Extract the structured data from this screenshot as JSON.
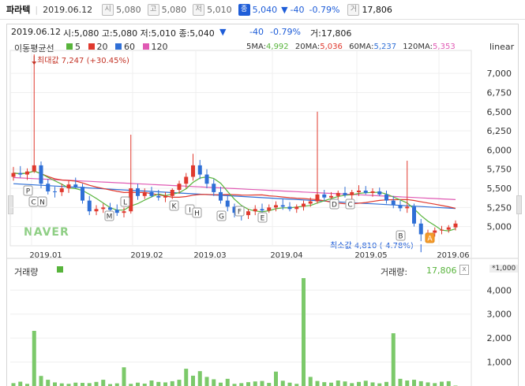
{
  "header": {
    "stock_name": "파라텍",
    "date": "2019.06.12",
    "open_icon": "시",
    "open": "5,080",
    "high_icon": "고",
    "high": "5,080",
    "low_icon": "저",
    "low": "5,010",
    "close_icon": "종",
    "close": "5,040",
    "change_arrow": "▼",
    "change": "-40",
    "change_pct": "-0.79%",
    "volume_icon": "거",
    "volume": "17,806"
  },
  "info_bar": {
    "date": "2019.06.12",
    "ohlc": "시:5,080  고:5,080  저:5,010  종:5,040",
    "change_arrow": "▼",
    "change": "-40",
    "change_pct": "-0.79%",
    "volume": "거:17,806"
  },
  "ma_legend": {
    "title": "이동평균선",
    "items": [
      {
        "label": "5",
        "color": "#58b43c"
      },
      {
        "label": "20",
        "color": "#e0392e"
      },
      {
        "label": "60",
        "color": "#2f6fd6"
      },
      {
        "label": "120",
        "color": "#e05ab4"
      }
    ],
    "values": [
      {
        "label": "5MA:",
        "value": "4,992",
        "color": "#58b43c"
      },
      {
        "label": "20MA:",
        "value": "5,036",
        "color": "#e0392e"
      },
      {
        "label": "60MA:",
        "value": "5,237",
        "color": "#2f6fd6"
      },
      {
        "label": "120MA:",
        "value": "5,353",
        "color": "#e05ab4"
      }
    ],
    "scale": "linear"
  },
  "annotations": {
    "max_label": "최대값 7,247 (+30.45%)",
    "min_label": "최소값 4,810 (-4.78%)",
    "watermark": "NAVER",
    "markers": [
      "P",
      "C",
      "N",
      "M",
      "L",
      "K",
      "I",
      "H",
      "G",
      "F",
      "E",
      "D",
      "C",
      "B",
      "A"
    ]
  },
  "volume_panel": {
    "title": "거래량",
    "label": "거래량:",
    "value": "17,806",
    "close_icon": "x",
    "unit": "*1,000"
  },
  "chart_data": [
    {
      "type": "candlestick",
      "title": "",
      "x": [
        "2019.01",
        "2019.02",
        "2019.03",
        "2019.04",
        "2019.05",
        "2019.06"
      ],
      "y_ticks": [
        5000,
        5250,
        5500,
        5750,
        6000,
        6250,
        6500,
        6750,
        7000
      ],
      "ylim": [
        4750,
        7300
      ],
      "ohlc_approx": [
        [
          5650,
          5780,
          5600,
          5700
        ],
        [
          5700,
          5790,
          5640,
          5680
        ],
        [
          5680,
          5760,
          5610,
          5720
        ],
        [
          5720,
          7247,
          5700,
          5800
        ],
        [
          5800,
          5850,
          5500,
          5560
        ],
        [
          5560,
          5620,
          5420,
          5460
        ],
        [
          5460,
          5520,
          5380,
          5450
        ],
        [
          5450,
          5560,
          5400,
          5500
        ],
        [
          5500,
          5600,
          5440,
          5550
        ],
        [
          5550,
          5640,
          5500,
          5520
        ],
        [
          5520,
          5560,
          5300,
          5340
        ],
        [
          5340,
          5400,
          5150,
          5200
        ],
        [
          5200,
          5280,
          5150,
          5230
        ],
        [
          5230,
          5300,
          5180,
          5250
        ],
        [
          5250,
          5310,
          5190,
          5220
        ],
        [
          5220,
          5290,
          5140,
          5180
        ],
        [
          5180,
          5250,
          5120,
          5200
        ],
        [
          5200,
          6200,
          5170,
          5500
        ],
        [
          5500,
          5560,
          5350,
          5400
        ],
        [
          5400,
          5500,
          5360,
          5450
        ],
        [
          5450,
          5520,
          5380,
          5400
        ],
        [
          5400,
          5480,
          5340,
          5380
        ],
        [
          5380,
          5450,
          5320,
          5400
        ],
        [
          5400,
          5500,
          5360,
          5480
        ],
        [
          5480,
          5600,
          5430,
          5560
        ],
        [
          5560,
          5700,
          5500,
          5650
        ],
        [
          5650,
          5950,
          5600,
          5800
        ],
        [
          5800,
          5870,
          5620,
          5680
        ],
        [
          5680,
          5750,
          5500,
          5560
        ],
        [
          5560,
          5620,
          5400,
          5450
        ],
        [
          5450,
          5520,
          5300,
          5340
        ],
        [
          5340,
          5400,
          5200,
          5260
        ],
        [
          5260,
          5300,
          5120,
          5180
        ],
        [
          5180,
          5260,
          5080,
          5150
        ],
        [
          5150,
          5230,
          5100,
          5200
        ],
        [
          5200,
          5280,
          5150,
          5230
        ],
        [
          5230,
          5300,
          5160,
          5210
        ],
        [
          5210,
          5290,
          5180,
          5250
        ],
        [
          5250,
          5330,
          5200,
          5280
        ],
        [
          5280,
          5360,
          5220,
          5260
        ],
        [
          5260,
          5320,
          5200,
          5230
        ],
        [
          5230,
          5290,
          5180,
          5260
        ],
        [
          5260,
          5340,
          5210,
          5300
        ],
        [
          5300,
          5380,
          5260,
          5330
        ],
        [
          5330,
          6500,
          5300,
          5420
        ],
        [
          5420,
          5480,
          5340,
          5380
        ],
        [
          5380,
          5450,
          5320,
          5400
        ],
        [
          5400,
          5470,
          5360,
          5440
        ],
        [
          5440,
          5520,
          5380,
          5410
        ],
        [
          5410,
          5480,
          5360,
          5450
        ],
        [
          5450,
          5540,
          5400,
          5470
        ],
        [
          5470,
          5530,
          5420,
          5440
        ],
        [
          5440,
          5500,
          5390,
          5460
        ],
        [
          5460,
          5510,
          5400,
          5420
        ],
        [
          5420,
          5470,
          5300,
          5340
        ],
        [
          5340,
          5400,
          5240,
          5280
        ],
        [
          5280,
          5340,
          5200,
          5240
        ],
        [
          5240,
          5860,
          5180,
          5260
        ],
        [
          5260,
          5300,
          5000,
          5040
        ],
        [
          5040,
          5100,
          4810,
          4900
        ],
        [
          4900,
          4960,
          4840,
          4920
        ],
        [
          4920,
          4990,
          4870,
          4950
        ],
        [
          4950,
          5010,
          4900,
          4960
        ],
        [
          4960,
          5020,
          4920,
          4990
        ],
        [
          4990,
          5080,
          4950,
          5040
        ]
      ],
      "ma": {
        "5MA": 4992,
        "20MA": 5036,
        "60MA": 5237,
        "120MA": 5353
      },
      "max": {
        "value": 7247,
        "pct": "+30.45%"
      },
      "min": {
        "value": 4810,
        "pct": "-4.78%"
      }
    },
    {
      "type": "bar",
      "title": "",
      "unit": "*1,000",
      "y_ticks": [
        1000,
        2000,
        3000,
        4000
      ],
      "ylim": [
        0,
        4600
      ],
      "values": [
        120,
        180,
        90,
        2300,
        420,
        260,
        150,
        110,
        90,
        140,
        130,
        120,
        170,
        260,
        80,
        110,
        780,
        90,
        140,
        100,
        230,
        170,
        150,
        200,
        260,
        720,
        430,
        620,
        380,
        280,
        140,
        300,
        90,
        120,
        160,
        190,
        210,
        130,
        600,
        220,
        140,
        90,
        4500,
        380,
        210,
        160,
        140,
        230,
        190,
        120,
        170,
        220,
        150,
        110,
        170,
        2200,
        300,
        230,
        260,
        200,
        150,
        120,
        180,
        200,
        18
      ]
    }
  ]
}
